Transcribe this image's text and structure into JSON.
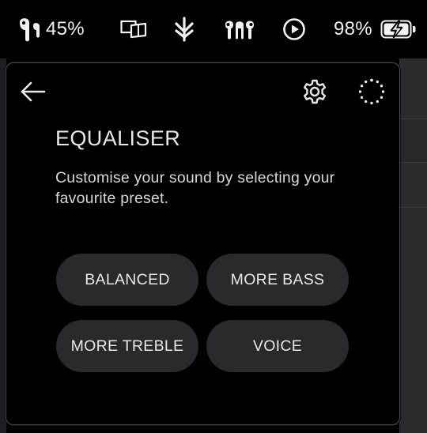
{
  "menubar": {
    "earbud_battery": "45%",
    "mac_battery": "98%",
    "icons": [
      "earbud-icon",
      "display-mirror-icon",
      "bluetooth-icon",
      "airpods-icon",
      "play-circle-icon",
      "battery-charging-icon"
    ]
  },
  "panel": {
    "title": "EQUALISER",
    "description": "Customise your sound by selecting your favourite preset.",
    "presets": [
      "BALANCED",
      "MORE BASS",
      "MORE TREBLE",
      "VOICE"
    ]
  },
  "colors": {
    "panel_bg": "#000000",
    "button_bg": "#2a2a2c",
    "text": "#e8e8e8",
    "border": "#4a4a4c"
  }
}
